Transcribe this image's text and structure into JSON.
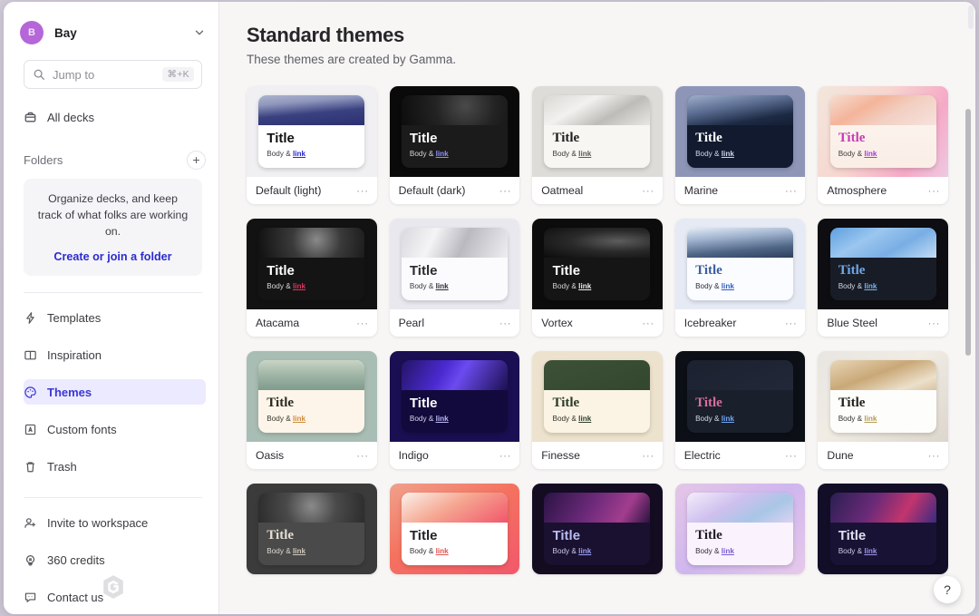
{
  "workspace": {
    "avatar_letter": "B",
    "name": "Bay",
    "chevron_icon": "chevron-down-icon"
  },
  "search": {
    "placeholder": "Jump to",
    "shortcut": "⌘+K",
    "icon": "search-icon"
  },
  "sidebar": {
    "all_decks": {
      "label": "All decks",
      "icon": "deck-icon"
    },
    "folders_heading": "Folders",
    "add_folder_icon": "plus-icon",
    "folders_empty": {
      "message": "Organize decks, and keep track of what folks are working on.",
      "cta": "Create or join a folder"
    },
    "nav": [
      {
        "label": "Templates",
        "icon": "lightning-icon",
        "active": false
      },
      {
        "label": "Inspiration",
        "icon": "book-icon",
        "active": false
      },
      {
        "label": "Themes",
        "icon": "palette-icon",
        "active": true
      },
      {
        "label": "Custom fonts",
        "icon": "font-icon",
        "active": false
      },
      {
        "label": "Trash",
        "icon": "trash-icon",
        "active": false
      }
    ],
    "secondary_nav": [
      {
        "label": "Invite to workspace",
        "icon": "user-plus-icon"
      },
      {
        "label": "360 credits",
        "icon": "credits-icon"
      },
      {
        "label": "Contact us",
        "icon": "chat-icon"
      }
    ],
    "logo": "gamma-logo"
  },
  "main": {
    "title": "Standard themes",
    "subtitle": "These themes are created by Gamma.",
    "menu_dots": "···",
    "help_label": "?",
    "sample": {
      "title": "Title",
      "body_prefix": "Body & ",
      "link": "link"
    }
  },
  "themes": [
    {
      "name": "Default (light)",
      "card_bg": "#f0eff2",
      "slide_bg": "#ffffff",
      "title_color": "#111114",
      "body_color": "#3c3c44",
      "link_color": "#2626d6",
      "title_font": "sans",
      "img": "linear-gradient(175deg,#aeb4ce 0%,#8f97bd 26%,#3a4180 58%,#2b3070 100%)"
    },
    {
      "name": "Default (dark)",
      "card_bg": "#0a0a0a",
      "slide_bg": "#1b1b1b",
      "title_color": "#ffffff",
      "body_color": "#d5d5da",
      "link_color": "#8f8fff",
      "title_font": "sans",
      "img": "radial-gradient(circle at 60% 35%,#4a4a4a 0%,#232323 45%,#0d0d0d 100%)"
    },
    {
      "name": "Oatmeal",
      "card_bg": "#dddcd8",
      "slide_bg": "#f7f6f3",
      "title_color": "#1d1d1d",
      "body_color": "#3a3a3a",
      "link_color": "#5a5a52",
      "title_font": "serif",
      "img": "linear-gradient(150deg,#d9d8d4 0%,#f2f1ef 35%,#bdbcb8 65%,#e8e7e4 100%)"
    },
    {
      "name": "Marine",
      "card_bg": "#8e96b8",
      "slide_bg": "#111a2e",
      "title_color": "#ffffff",
      "body_color": "#d5dae6",
      "link_color": "#cfd6ea",
      "title_font": "serif",
      "img": "linear-gradient(170deg,#9fb0cc 0%,#5a6c90 40%,#1d2a44 75%,#141e33 100%)"
    },
    {
      "name": "Atmosphere",
      "card_bg": "linear-gradient(120deg,#f2e7dd 0%,#f7d6cf 40%,#f5a9c6 75%,#eec9e2 100%)",
      "slide_bg": "linear-gradient(180deg,#fdf6f1 0%,#faeee6 100%)",
      "title_color": "#c63bb5",
      "body_color": "#3a3a42",
      "link_color": "#a83ad8",
      "title_font": "serif",
      "img": "linear-gradient(150deg,#f6ddd0 0%,#f4b49a 35%,#f2cfc2 60%,#f7e2dc 100%)"
    },
    {
      "name": "Atacama",
      "card_bg": "#121212",
      "slide_bg": "#141414",
      "title_color": "#ffffff",
      "body_color": "#d8d8dd",
      "link_color": "#e0325e",
      "title_font": "sans",
      "img": "radial-gradient(circle at 55% 40%,#8a8a8a 0%,#3a3a3a 40%,#101010 100%)"
    },
    {
      "name": "Pearl",
      "card_bg": "#e9e8ee",
      "slide_bg": "#fbfbfd",
      "title_color": "#2a2a30",
      "body_color": "#3a3a42",
      "link_color": "#2c2c34",
      "title_font": "sans",
      "img": "linear-gradient(115deg,#d9d9de 0%,#f4f4f6 30%,#b9b9c0 58%,#efeff2 100%)"
    },
    {
      "name": "Vortex",
      "card_bg": "#0c0c0c",
      "slide_bg": "#151515",
      "title_color": "#ffffff",
      "body_color": "#d6d6db",
      "link_color": "#ededf2",
      "title_font": "sans",
      "img": "radial-gradient(ellipse at 70% 45%,#5d5d5d 0%,#2a2a2a 45%,#0b0b0b 100%)"
    },
    {
      "name": "Icebreaker",
      "card_bg": "#e6eaf4",
      "slide_bg": "#fbfcff",
      "title_color": "#3a5f9e",
      "body_color": "#2d2d35",
      "link_color": "#2f5fc0",
      "title_font": "serif",
      "img": "linear-gradient(175deg,#e4ecf6 0%,#9cb0cc 35%,#4f6585 70%,#2e3f5c 100%)"
    },
    {
      "name": "Blue Steel",
      "card_bg": "#0e0e12",
      "slide_bg": "#181c26",
      "title_color": "#6fa8e8",
      "body_color": "#d2d6df",
      "link_color": "#7ab3ec",
      "title_font": "serif",
      "img": "linear-gradient(150deg,#5e9fe0 0%,#9bc6ef 35%,#79aee4 65%,#c3dcf6 100%)"
    },
    {
      "name": "Oasis",
      "card_bg": "#a8bdb4",
      "slide_bg": "#fdf5e9",
      "title_color": "#2a2a22",
      "body_color": "#39392f",
      "link_color": "#d08b3e",
      "title_font": "serif",
      "img": "linear-gradient(180deg,#c9d5c4 0%,#9fb5a6 50%,#7e9b8c 100%)"
    },
    {
      "name": "Indigo",
      "card_bg": "#1a0f52",
      "slide_bg": "#120a3c",
      "title_color": "#ffffff",
      "body_color": "#d4d4ec",
      "link_color": "#b9b9f5",
      "title_font": "sans",
      "img": "linear-gradient(120deg,#241463 0%,#4a2ad0 38%,#6b4bf0 55%,#1c1050 100%)"
    },
    {
      "name": "Finesse",
      "card_bg": "#ece2cd",
      "slide_bg": "#fbf4e4",
      "title_color": "#2b3a2a",
      "body_color": "#33332c",
      "link_color": "#2f3f2e",
      "title_font": "serif",
      "img": "linear-gradient(160deg,#3c5138 0%,#33472f 100%)"
    },
    {
      "name": "Electric",
      "card_bg": "#0c0f16",
      "slide_bg": "#1a1f2c",
      "title_color": "#d66f9e",
      "body_color": "#d6dae4",
      "link_color": "#6fa8f5",
      "title_font": "serif",
      "img": "linear-gradient(160deg,#1c2130 0%,#222838 100%)"
    },
    {
      "name": "Dune",
      "card_bg": "linear-gradient(140deg,#e8e6e2 0%,#f1ece4 45%,#dcd6cc 100%)",
      "slide_bg": "#fdfdfb",
      "title_color": "#221f1a",
      "body_color": "#35322c",
      "link_color": "#b59a55",
      "title_font": "serif",
      "img": "linear-gradient(160deg,#e8d6b8 0%,#c9a877 45%,#ece0cb 80%,#d8c3a0 100%)"
    },
    {
      "name": "",
      "card_bg": "#3b3b3b",
      "slide_bg": "#4a4a4a",
      "title_color": "#e5ddd3",
      "body_color": "#ddd8d0",
      "link_color": "#cfc7bc",
      "title_font": "serif",
      "img": "radial-gradient(circle at 50% 45%,#8a8a8a 0%,#4a4a4a 45%,#2c2c2c 100%)"
    },
    {
      "name": "",
      "card_bg": "linear-gradient(150deg,#f0a18c 0%,#f4725f 45%,#f2586b 100%)",
      "slide_bg": "#ffffff",
      "title_color": "#222226",
      "body_color": "#37373d",
      "link_color": "#e0554f",
      "title_font": "sans",
      "img": "linear-gradient(150deg,#fbf1ec 0%,#f5a993 45%,#f2566b 100%)"
    },
    {
      "name": "",
      "card_bg": "#140d22",
      "slide_bg": "#1a1030",
      "title_color": "#b8bdf0",
      "body_color": "#c9cbe8",
      "link_color": "#9aa0ee",
      "title_font": "sans",
      "img": "linear-gradient(120deg,#2a1344 0%,#6d2a7a 45%,#a33d8e 75%,#2b1340 100%)"
    },
    {
      "name": "",
      "card_bg": "linear-gradient(140deg,#e5c6e8 0%,#cfb6ee 50%,#e7c9ea 100%)",
      "slide_bg": "#faf2fc",
      "title_color": "#201c28",
      "body_color": "#35303c",
      "link_color": "#7a5ad0",
      "title_font": "serif",
      "img": "linear-gradient(150deg,#f4eefb 0%,#cfc0ee 40%,#a8c6e6 70%,#dcd2f3 100%)"
    },
    {
      "name": "",
      "card_bg": "#120e28",
      "slide_bg": "#181334",
      "title_color": "#e2def0",
      "body_color": "#ccc8e2",
      "link_color": "#9a93e8",
      "title_font": "sans",
      "img": "linear-gradient(120deg,#2a1f52 0%,#6a2a78 40%,#c2356e 70%,#3a2a80 100%)"
    }
  ]
}
